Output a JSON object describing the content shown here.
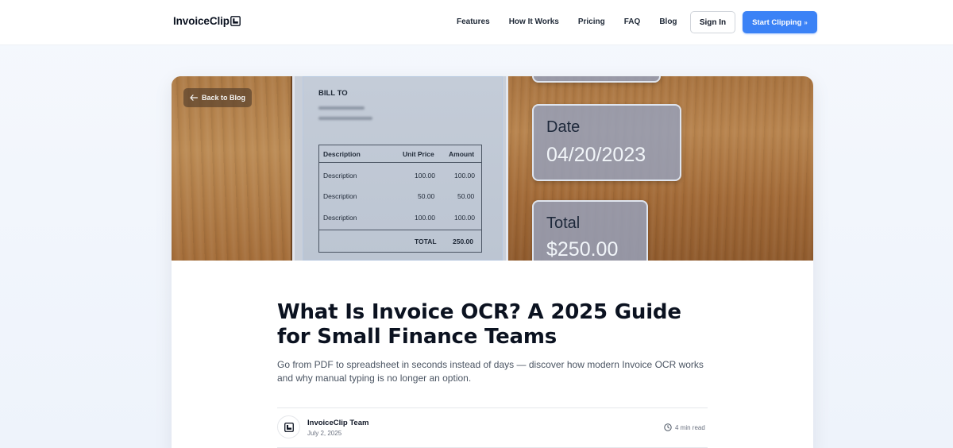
{
  "header": {
    "brand": "InvoiceClip",
    "nav": [
      "Features",
      "How It Works",
      "Pricing",
      "FAQ",
      "Blog"
    ],
    "sign_in": "Sign In",
    "start": "Start Clipping",
    "start_suffix": "»"
  },
  "hero": {
    "back_label": "Back to Blog",
    "invoice": {
      "bill_to": "BILL TO",
      "headers": [
        "Description",
        "Unit Price",
        "Amount"
      ],
      "rows": [
        [
          "Description",
          "100.00",
          "100.00"
        ],
        [
          "Description",
          "50.00",
          "50.00"
        ],
        [
          "Description",
          "100.00",
          "100.00"
        ]
      ],
      "total_label": "TOTAL",
      "total_value": "250.00"
    },
    "date_tag": {
      "label": "Date",
      "value": "04/20/2023"
    },
    "total_tag": {
      "label": "Total",
      "value": "$250.00"
    }
  },
  "article": {
    "title": "What Is Invoice OCR? A 2025 Guide for Small Finance Teams",
    "subtitle": "Go from PDF to spreadsheet in seconds instead of days — discover how modern Invoice OCR works and why manual typing is no longer an option.",
    "author": "InvoiceClip Team",
    "date": "July 2, 2025",
    "read_time": "4 min read"
  },
  "colors": {
    "accent": "#3b82f6",
    "title": "#0b1220",
    "muted": "#6b7280"
  }
}
